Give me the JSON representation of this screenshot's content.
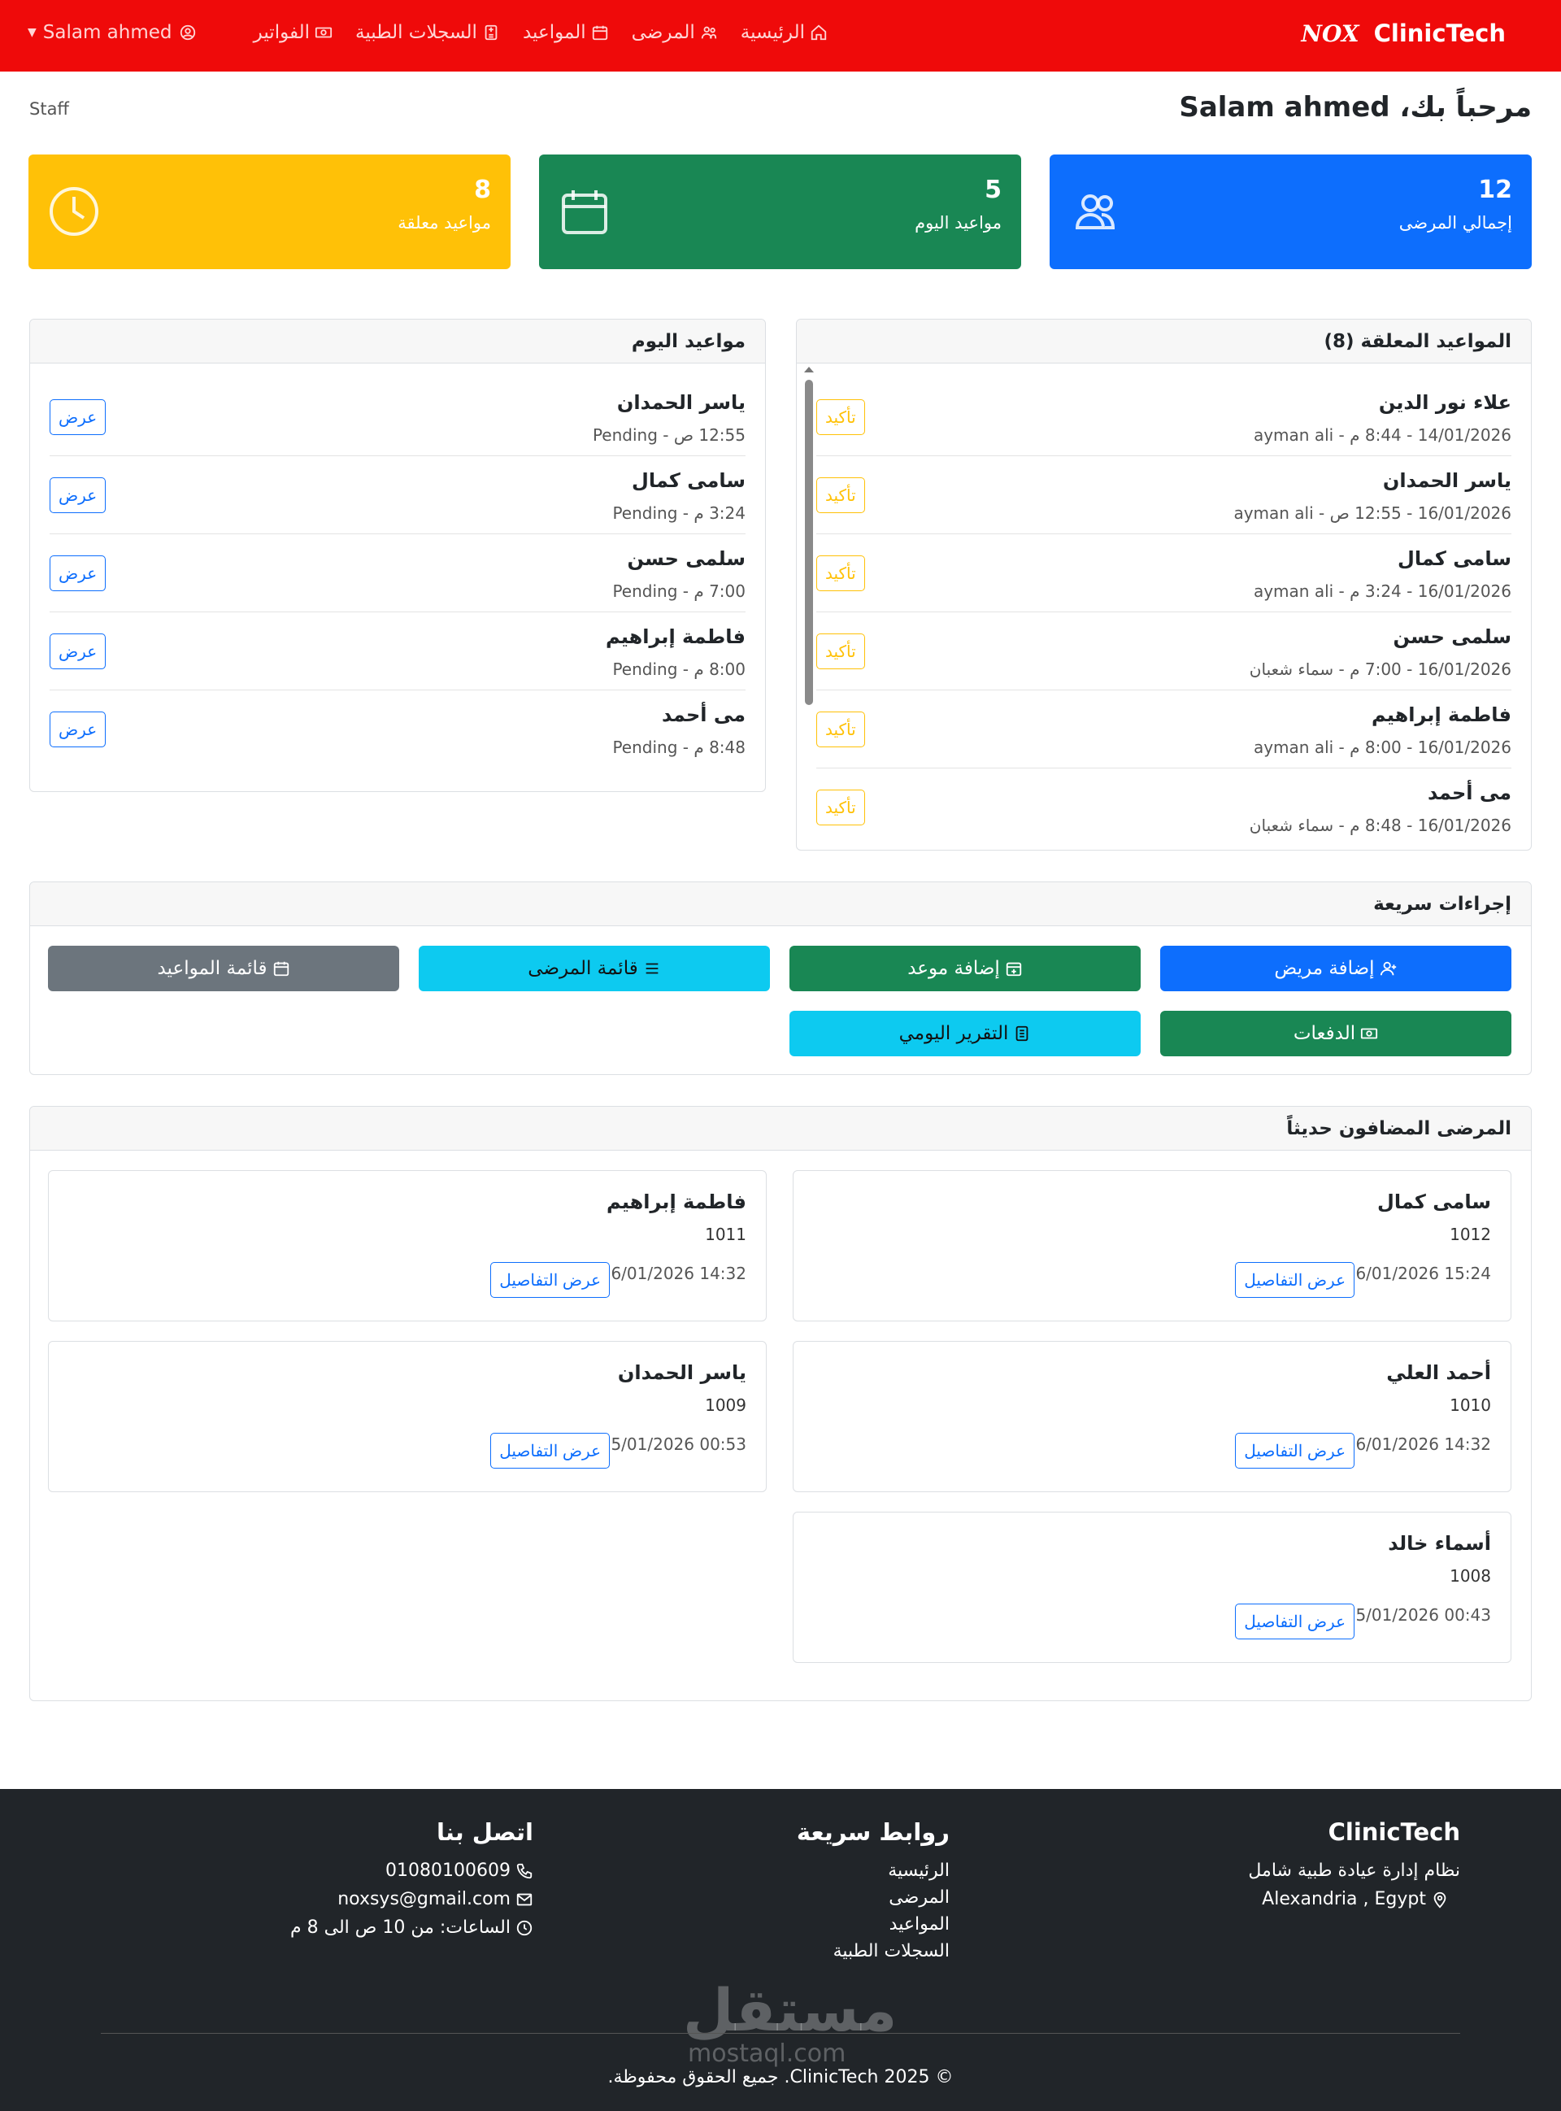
{
  "navbar": {
    "brand": "ClinicTech",
    "brand_logo": "NOX",
    "links": [
      "الرئيسية",
      "المرضى",
      "المواعيد",
      "السجلات الطبية",
      "الفواتير"
    ],
    "user": "Salam ahmed"
  },
  "welcome": "مرحباً بك، Salam ahmed",
  "role": "Staff",
  "stats": [
    {
      "value": "12",
      "label": "إجمالي المرضى",
      "color": "#0d6efd"
    },
    {
      "value": "5",
      "label": "مواعيد اليوم",
      "color": "#198754"
    },
    {
      "value": "8",
      "label": "مواعيد معلقة",
      "color": "#ffc107"
    }
  ],
  "pending": {
    "title": "المواعيد المعلقة (8)",
    "action": "تأكيد",
    "items": [
      {
        "name": "علاء نور الدين",
        "meta": "14/01/2026 - 8:44 م - ayman ali"
      },
      {
        "name": "ياسر الحمدان",
        "meta": "16/01/2026 - 12:55 ص - ayman ali"
      },
      {
        "name": "سامى كمال",
        "meta": "16/01/2026 - 3:24 م - ayman ali"
      },
      {
        "name": "سلمى حسن",
        "meta": "16/01/2026 - 7:00 م - سماء شعبان"
      },
      {
        "name": "فاطمة إبراهيم",
        "meta": "16/01/2026 - 8:00 م - ayman ali"
      },
      {
        "name": "مى أحمد",
        "meta": "16/01/2026 - 8:48 م - سماء شعبان"
      }
    ]
  },
  "today": {
    "title": "مواعيد اليوم",
    "action": "عرض",
    "items": [
      {
        "name": "ياسر الحمدان",
        "meta": "12:55 ص - Pending"
      },
      {
        "name": "سامى كمال",
        "meta": "3:24 م - Pending"
      },
      {
        "name": "سلمى حسن",
        "meta": "7:00 م - Pending"
      },
      {
        "name": "فاطمة إبراهيم",
        "meta": "8:00 م - Pending"
      },
      {
        "name": "مى أحمد",
        "meta": "8:48 م - Pending"
      }
    ]
  },
  "quick_actions": {
    "title": "إجراءات سريعة",
    "buttons": [
      {
        "label": "إضافة مريض",
        "color": "#0d6efd"
      },
      {
        "label": "إضافة موعد",
        "color": "#198754"
      },
      {
        "label": "قائمة المرضى",
        "color": "#0dcaf0"
      },
      {
        "label": "قائمة المواعيد",
        "color": "#6c757d"
      },
      {
        "label": "الدفعات",
        "color": "#198754"
      },
      {
        "label": "التقرير اليومي",
        "color": "#0dcaf0"
      }
    ]
  },
  "recent_patients": {
    "title": "المرضى المضافون حديثاً",
    "details_label": "عرض التفاصيل",
    "items": [
      {
        "name": "سامى كمال",
        "id": "1012",
        "date": "16/01/2026 15:24"
      },
      {
        "name": "فاطمة إبراهيم",
        "id": "1011",
        "date": "16/01/2026 14:32"
      },
      {
        "name": "أحمد العلي",
        "id": "1010",
        "date": "16/01/2026 14:32"
      },
      {
        "name": "ياسر الحمدان",
        "id": "1009",
        "date": "15/01/2026 00:53"
      },
      {
        "name": "أسماء خالد",
        "id": "1008",
        "date": "15/01/2026 00:43"
      }
    ]
  },
  "footer": {
    "brand": "ClinicTech",
    "tagline": "نظام إدارة عيادة طبية شامل",
    "location": "Alexandria , Egypt",
    "links_title": "روابط سريعة",
    "links": [
      "الرئيسية",
      "المرضى",
      "المواعيد",
      "السجلات الطبية"
    ],
    "contact_title": "اتصل بنا",
    "phone": "01080100609",
    "email": "noxsys@gmail.com",
    "hours": "الساعات: من 10 ص الى 8 م",
    "copyright": "© 2025 ClinicTech. جميع الحقوق محفوظة.",
    "watermark": "مستقل",
    "watermark_sub": "mostaql.com"
  }
}
